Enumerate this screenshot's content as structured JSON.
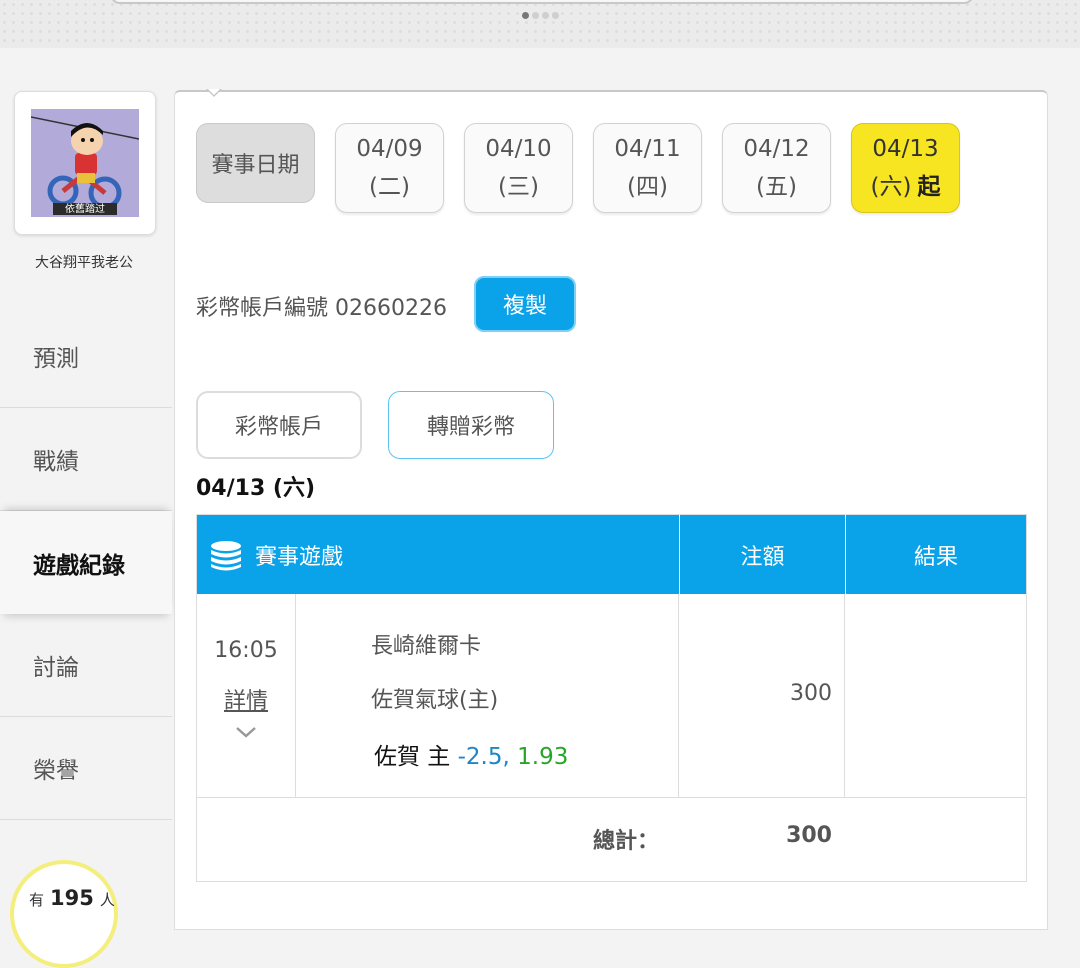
{
  "profile": {
    "avatar_caption": "依舊踏过",
    "username": "大谷翔平我老公"
  },
  "nav": [
    {
      "label": "預測",
      "active": false
    },
    {
      "label": "戰績",
      "active": false
    },
    {
      "label": "遊戲紀錄",
      "active": true
    },
    {
      "label": "討論",
      "active": false
    },
    {
      "label": "榮譽",
      "active": false
    }
  ],
  "online": {
    "prefix": "有",
    "count": "195",
    "suffix": "人"
  },
  "date_picker": {
    "label": "賽事日期",
    "dates": [
      {
        "date": "04/09",
        "weekday": "(二)",
        "suffix": "",
        "active": false
      },
      {
        "date": "04/10",
        "weekday": "(三)",
        "suffix": "",
        "active": false
      },
      {
        "date": "04/11",
        "weekday": "(四)",
        "suffix": "",
        "active": false
      },
      {
        "date": "04/12",
        "weekday": "(五)",
        "suffix": "",
        "active": false
      },
      {
        "date": "04/13",
        "weekday": "(六)",
        "suffix": "起",
        "active": true
      }
    ]
  },
  "account": {
    "label": "彩幣帳戶編號",
    "number": "02660226",
    "copy_label": "複製"
  },
  "tabs": {
    "account": "彩幣帳戶",
    "transfer": "轉贈彩幣"
  },
  "section_date": "04/13 (六)",
  "table": {
    "headers": {
      "game": "賽事遊戲",
      "bet": "注額",
      "result": "結果"
    },
    "rows": [
      {
        "time": "16:05",
        "detail_label": "詳情",
        "away_team": "長崎維爾卡",
        "home_team": "佐賀氣球(主)",
        "pick_team": "佐賀 主 ",
        "pick_line": "-2.5,",
        "pick_odds": " 1.93",
        "amount": "300",
        "result": ""
      }
    ],
    "total_label": "總計：",
    "total_value": "300"
  },
  "colors": {
    "accent_blue": "#0aa3ea",
    "active_yellow": "#f7e521",
    "line_blue": "#1c86c8",
    "odds_green": "#26a626"
  }
}
